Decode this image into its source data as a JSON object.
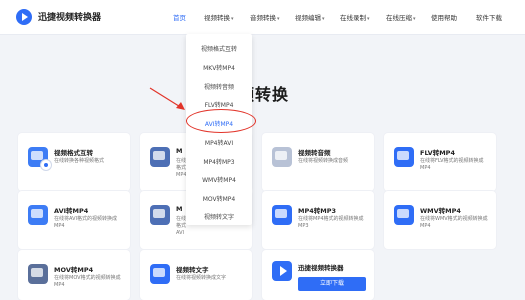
{
  "header": {
    "brand": "迅捷视频转换器",
    "nav": [
      {
        "label": "首页",
        "active": true,
        "caret": false
      },
      {
        "label": "视频转换",
        "active": false,
        "caret": true
      },
      {
        "label": "音频转换",
        "active": false,
        "caret": true
      },
      {
        "label": "视频编辑",
        "active": false,
        "caret": true
      },
      {
        "label": "在线录制",
        "active": false,
        "caret": true
      },
      {
        "label": "在线压缩",
        "active": false,
        "caret": true
      },
      {
        "label": "使用帮助",
        "active": false,
        "caret": false
      },
      {
        "label": "软件下载",
        "active": false,
        "caret": false
      }
    ],
    "caret_glyph": "▾"
  },
  "main": {
    "heading": "频转换"
  },
  "dropdown": {
    "items": [
      "视频格式互转",
      "MKV转MP4",
      "视频转音频",
      "FLV转MP4",
      "AVI转MP4",
      "MP4转AVI",
      "MP4转MP3",
      "WMV转MP4",
      "MOV转MP4",
      "视频转文字"
    ],
    "highlighted_index": 4
  },
  "cards": [
    {
      "title": "视频格式互转",
      "desc": "在线转换各种视频格式",
      "color": "#3d7cf5"
    },
    {
      "title": "M",
      "desc": "在线\n格式\nMP4",
      "color": "#4d6fb5"
    },
    {
      "title": "视频转音频",
      "desc": "在线将视频转换成音频",
      "color": "#b8c2d6"
    },
    {
      "title": "FLV转MP4",
      "desc": "在线将FLV格式的视频转换成MP4",
      "color": "#2f6df6"
    },
    {
      "title": "AVI转MP4",
      "desc": "在线将AVI格式的视频转换成MP4",
      "color": "#3d7cf5"
    },
    {
      "title": "M",
      "desc": "在线\n格式\nAVI",
      "color": "#4d6fb5"
    },
    {
      "title": "MP4转MP3",
      "desc": "在线将MP4格式的视频转换成MP3",
      "color": "#2f6df6"
    },
    {
      "title": "WMV转MP4",
      "desc": "在线将WMV格式的视频转换成MP4",
      "color": "#2f6df6"
    },
    {
      "title": "MOV转MP4",
      "desc": "在线将MOV格式的视频转换成MP4",
      "color": "#5a6f9a"
    },
    {
      "title": "视频转文字",
      "desc": "在线将视频转换成文字",
      "color": "#2f6df6"
    }
  ],
  "promo": {
    "title": "迅捷视频转换器",
    "button": "立即下载",
    "color": "#2f6df6"
  },
  "annotation": {
    "color": "#e2342a"
  }
}
